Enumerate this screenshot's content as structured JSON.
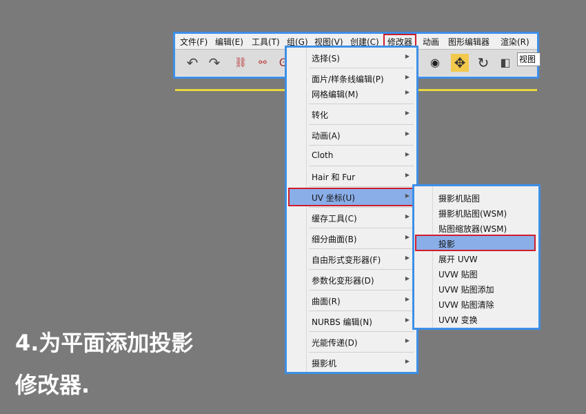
{
  "menubar": [
    "文件(F)",
    "编辑(E)",
    "工具(T)",
    "组(G)",
    "视图(V)",
    "创建(C)",
    "修改器",
    "动画",
    "图形编辑器",
    "渲染(R)"
  ],
  "active_menu": "修改器",
  "toolbar": {
    "view_label": "视图",
    "icons": [
      "undo-icon",
      "redo-icon",
      "link-icon",
      "unlink-icon",
      "bind-space-warp-icon",
      "selection-region-icon",
      "move-icon",
      "rotate-icon",
      "scale-icon"
    ]
  },
  "modifier_menu": [
    "选择(S)",
    "面片/样条线编辑(P)",
    "网格编辑(M)",
    "转化",
    "动画(A)",
    "Cloth",
    "Hair 和 Fur",
    "UV 坐标(U)",
    "缓存工具(C)",
    "细分曲面(B)",
    "自由形式变形器(F)",
    "参数化变形器(D)",
    "曲面(R)",
    "NURBS 编辑(N)",
    "光能传递(D)",
    "摄影机"
  ],
  "highlighted_item": "UV 坐标(U)",
  "uv_submenu": [
    "摄影机贴图",
    "摄影机贴图(WSM)",
    "贴图缩放器(WSM)",
    "投影",
    "展开 UVW",
    "UVW 贴图",
    "UVW 贴图添加",
    "UVW 贴图清除",
    "UVW 变换"
  ],
  "highlighted_sub": "投影",
  "caption": {
    "line1": "4.为平面添加投影",
    "line2": "修改器."
  },
  "colors": {
    "frame": "#3d8fe8",
    "highlight": "#8aaee8",
    "outline": "#d01c2a"
  }
}
